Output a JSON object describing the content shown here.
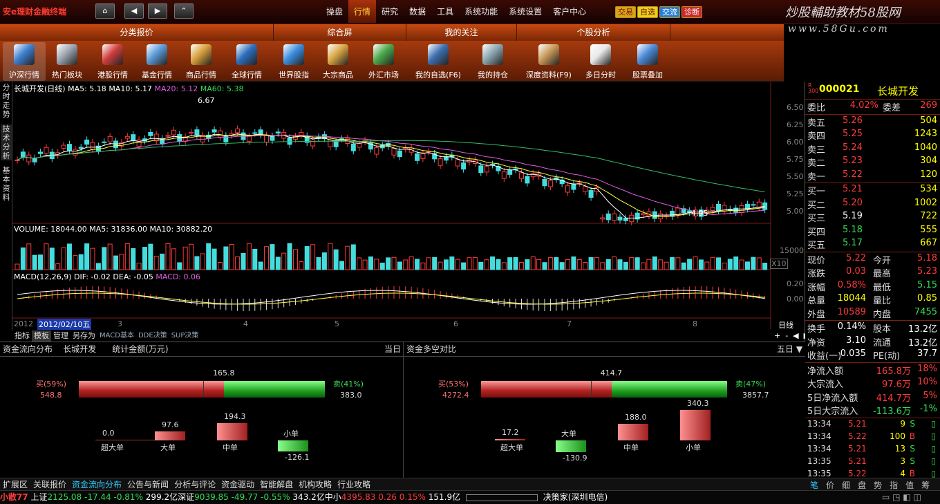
{
  "titlebar": {
    "logo": "安e理财金融终端",
    "nav": [
      "⌂",
      "◀",
      "▶",
      "⌃"
    ],
    "menu": [
      {
        "label": "操盘",
        "active": false
      },
      {
        "label": "行情",
        "active": true
      },
      {
        "label": "研究",
        "active": false
      },
      {
        "label": "数据",
        "active": false
      },
      {
        "label": "工具",
        "active": false
      },
      {
        "label": "系统功能",
        "active": false
      },
      {
        "label": "系统设置",
        "active": false
      },
      {
        "label": "客户中心",
        "active": false
      }
    ],
    "buttons": [
      {
        "label": "交易",
        "bg": "#d8a41a",
        "fg": "#7a1a00"
      },
      {
        "label": "自选",
        "bg": "#e6d11f",
        "fg": "#7a1a00"
      },
      {
        "label": "交流",
        "bg": "#2a7fd6",
        "fg": "#ffffff"
      },
      {
        "label": "诊断",
        "bg": "#c8282a",
        "fg": "#ffffff"
      }
    ],
    "brand": "炒股輔助教材58股网",
    "brand_url": "www.58Gu.com"
  },
  "categories": [
    "分类报价",
    "综合屏",
    "我的关注",
    "个股分析"
  ],
  "toolbar": [
    {
      "label": "沪深行情",
      "icon": "chart-window-icon",
      "color": "#3d7fd0",
      "active": true
    },
    {
      "label": "热门板块",
      "icon": "tornado-icon",
      "color": "#9aa4b0",
      "active": false
    },
    {
      "label": "港股行情",
      "icon": "hk-chart-icon",
      "color": "#d03d3d",
      "active": false
    },
    {
      "label": "基金行情",
      "icon": "fund-chart-icon",
      "color": "#5a9ad8",
      "active": false
    },
    {
      "label": "商品行情",
      "icon": "commodity-chart-icon",
      "color": "#d8a03d",
      "active": false
    },
    {
      "label": "全球行情",
      "icon": "globe-icon",
      "color": "#2d6fc0",
      "active": false
    },
    {
      "label": "世界股指",
      "icon": "world-index-icon",
      "color": "#3a8fe0",
      "active": false
    },
    {
      "label": "大宗商品",
      "icon": "bulk-goods-icon",
      "color": "#d8a645",
      "active": false
    },
    {
      "label": "外汇市场",
      "icon": "forex-icon",
      "color": "#4aa84a",
      "active": false
    },
    {
      "label": "我的自选(F6)",
      "icon": "user-watchlist-icon",
      "color": "#3d6fb0",
      "active": false
    },
    {
      "label": "我的持仓",
      "icon": "holdings-icon",
      "color": "#8aa6b0",
      "active": false
    },
    {
      "label": "深度资料(F9)",
      "icon": "document-icon",
      "color": "#c89a5a",
      "active": false
    },
    {
      "label": "多日分时",
      "icon": "calendar-icon",
      "color": "#e8e8e8",
      "active": false
    },
    {
      "label": "股票叠加",
      "icon": "overlay-window-icon",
      "color": "#4a8ad8",
      "active": false
    }
  ],
  "left_tabs": [
    "分时走势",
    "技术分析",
    "基本资料"
  ],
  "kline": {
    "header_name": "长城开发(日线)",
    "ma5": "MA5: 5.18",
    "ma10": "MA10: 5.17",
    "ma20": "MA20: 5.12",
    "ma60": "MA60: 5.38",
    "high_label": "6.67",
    "low_label": "4.95",
    "yticks": [
      "6.50",
      "6.25",
      "6.00",
      "5.75",
      "5.50",
      "5.25",
      "5.00"
    ]
  },
  "volume": {
    "header": "VOLUME: 18044.00",
    "ma5": "MA5: 31836.00",
    "ma10": "MA10: 30882.20",
    "ytick": "15000",
    "unit": "X10"
  },
  "macd": {
    "header": "MACD(12,26,9)",
    "dif": "DIF: -0.02",
    "dea": "DEA: -0.05",
    "macd": "MACD: 0.06",
    "yticks": [
      "0.20",
      "0.00"
    ]
  },
  "xaxis": {
    "start": "2012",
    "cursor_date": "2012/02/10",
    "weekday": "五",
    "months": [
      "3",
      "4",
      "5",
      "6",
      "7",
      "8"
    ],
    "period": "日线"
  },
  "bottom_tabs": [
    "指标",
    "模板",
    "管理",
    "另存为",
    "MACD基本",
    "DDE决策",
    "SUP决策"
  ],
  "quote": {
    "code": "000021",
    "name": "长城开发",
    "weibi_label": "委比",
    "weibi": "4.02%",
    "weicha_label": "委差",
    "weicha": "269",
    "sells": [
      {
        "label": "卖五",
        "price": "5.26",
        "vol": "504"
      },
      {
        "label": "卖四",
        "price": "5.25",
        "vol": "1243"
      },
      {
        "label": "卖三",
        "price": "5.24",
        "vol": "1040"
      },
      {
        "label": "卖二",
        "price": "5.23",
        "vol": "304"
      },
      {
        "label": "卖一",
        "price": "5.22",
        "vol": "120"
      }
    ],
    "buys": [
      {
        "label": "买一",
        "price": "5.21",
        "vol": "534"
      },
      {
        "label": "买二",
        "price": "5.20",
        "vol": "1002"
      },
      {
        "label": "买三",
        "price": "5.19",
        "vol": "722"
      },
      {
        "label": "买四",
        "price": "5.18",
        "vol": "555"
      },
      {
        "label": "买五",
        "price": "5.17",
        "vol": "667"
      }
    ],
    "stats": [
      [
        "现价",
        "5.22",
        "今开",
        "5.18"
      ],
      [
        "涨跌",
        "0.03",
        "最高",
        "5.23"
      ],
      [
        "涨幅",
        "0.58%",
        "最低",
        "5.15"
      ],
      [
        "总量",
        "18044",
        "量比",
        "0.85"
      ],
      [
        "外盘",
        "10589",
        "内盘",
        "7455"
      ]
    ],
    "stats2": [
      [
        "换手",
        "0.14%",
        "股本",
        "13.2亿"
      ],
      [
        "净资",
        "3.10",
        "流通",
        "13.2亿"
      ],
      [
        "收益(一)",
        "0.035",
        "PE(动)",
        "37.7"
      ]
    ],
    "flows": [
      [
        "净流入额",
        "165.8万",
        "18%"
      ],
      [
        "大宗流入",
        "97.6万",
        "10%"
      ],
      [
        "5日净流入额",
        "414.7万",
        "5%"
      ],
      [
        "5日大宗流入",
        "-113.6万",
        "-1%"
      ]
    ],
    "ticks": [
      [
        "13:34",
        "5.21",
        "9",
        "S"
      ],
      [
        "13:34",
        "5.22",
        "100",
        "B"
      ],
      [
        "13:34",
        "5.21",
        "13",
        "S"
      ],
      [
        "13:35",
        "5.21",
        "3",
        "S"
      ],
      [
        "13:35",
        "5.22",
        "4",
        "B"
      ]
    ],
    "bottom_tabs": [
      "笔",
      "价",
      "细",
      "盘",
      "势",
      "指",
      "值",
      "筹"
    ]
  },
  "fund_left": {
    "title": "资金流向分布",
    "stock": "长城开发",
    "unit_label": "统计金额(万元)",
    "period": "当日",
    "net": "165.8",
    "buy_label": "买(59%)",
    "buy_value": "548.8",
    "buy_pct": 59,
    "sell_label": "卖(41%)",
    "sell_value": "383.0",
    "orders": [
      {
        "name": "超大单",
        "value": "0.0",
        "num": 0
      },
      {
        "name": "大单",
        "value": "97.6",
        "num": 97.6
      },
      {
        "name": "中单",
        "value": "194.3",
        "num": 194.3
      },
      {
        "name": "小单",
        "value": "-126.1",
        "num": -126.1
      }
    ]
  },
  "fund_right": {
    "title": "资金多空对比",
    "period": "五日",
    "net": "414.7",
    "buy_label": "买(53%)",
    "buy_value": "4272.4",
    "buy_pct": 53,
    "sell_label": "卖(47%)",
    "sell_value": "3857.7",
    "orders": [
      {
        "name": "超大单",
        "value": "17.2",
        "num": 17.2
      },
      {
        "name": "大单",
        "value": "-130.9",
        "num": -130.9
      },
      {
        "name": "中单",
        "value": "188.0",
        "num": 188.0
      },
      {
        "name": "小单",
        "value": "340.3",
        "num": 340.3
      }
    ]
  },
  "statusbar": [
    "扩展区",
    "关联报价",
    "资金流向分布",
    "公告与新闻",
    "分析与评论",
    "资金驱动",
    "智能解盘",
    "机构攻略",
    "行业攻略"
  ],
  "ticker": {
    "tag": "小散77",
    "sh_label": "上证",
    "sh_val": "2125.08",
    "sh_chg": "-17.44",
    "sh_pct": "-0.81%",
    "sh_amt": "299.2亿",
    "sz_label": "深证",
    "sz_val": "9039.85",
    "sz_chg": "-49.77",
    "sz_pct": "-0.55%",
    "sz_amt": "343.2亿",
    "zx_label": "中小",
    "zx_val": "4395.83",
    "zx_chg": "0.26",
    "zx_pct": "0.15%",
    "zx_amt": "151.9亿",
    "server": "决策家(深圳电信)"
  }
}
